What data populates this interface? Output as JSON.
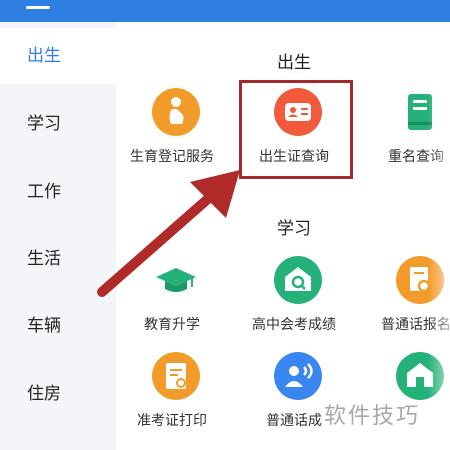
{
  "sidebar": {
    "items": [
      {
        "label": "出生",
        "active": true
      },
      {
        "label": "学习"
      },
      {
        "label": "工作"
      },
      {
        "label": "生活"
      },
      {
        "label": "车辆"
      },
      {
        "label": "住房"
      }
    ]
  },
  "sections": {
    "birth": {
      "title": "出生",
      "tiles": [
        {
          "label": "生育登记服务",
          "icon": "pregnancy-icon",
          "color": "#f29b2b"
        },
        {
          "label": "出生证查询",
          "icon": "id-card-icon",
          "color": "#f15a3a"
        },
        {
          "label": "重名查询",
          "icon": "notebook-icon",
          "color": "#24b27a"
        }
      ]
    },
    "study": {
      "title": "学习",
      "tiles": [
        {
          "label": "教育升学",
          "icon": "graduation-cap-icon",
          "color": "#24b27a"
        },
        {
          "label": "高中会考成绩",
          "icon": "school-search-icon",
          "color": "#24b27a"
        },
        {
          "label": "普通话报名",
          "icon": "document-search-icon",
          "color": "#f29b2b"
        },
        {
          "label": "准考证打印",
          "icon": "ticket-print-icon",
          "color": "#f29b2b"
        },
        {
          "label": "普通话成",
          "icon": "speech-person-icon",
          "color": "#3a86f0"
        },
        {
          "label": "",
          "icon": "school-icon",
          "color": "#24b27a"
        }
      ]
    }
  },
  "watermark": "软件技巧",
  "colors": {
    "accent": "#2f7fe3",
    "highlight": "#a32a2a"
  }
}
